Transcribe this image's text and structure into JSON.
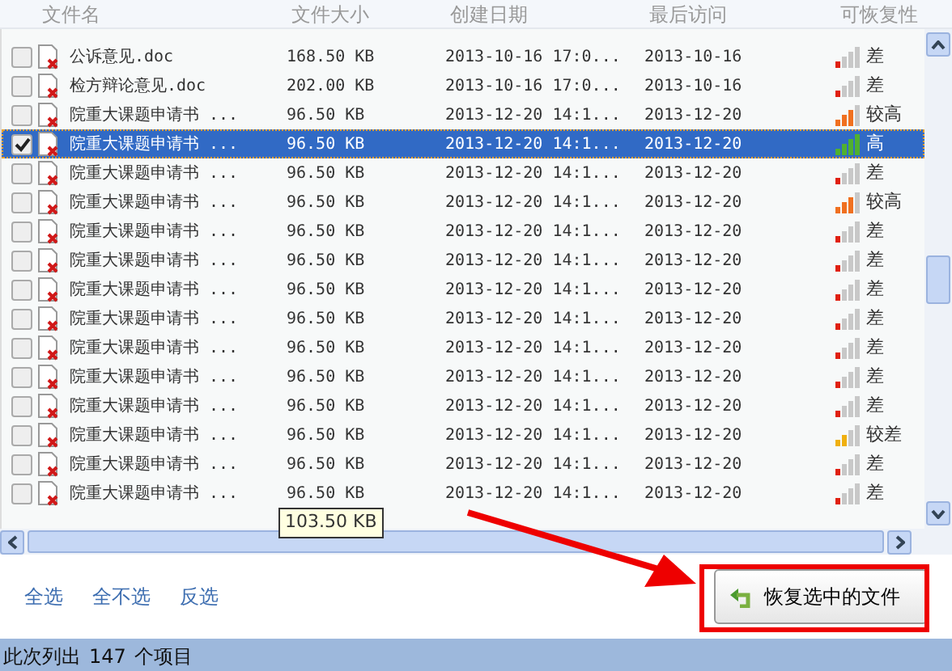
{
  "table": {
    "columns": [
      "文件名",
      "文件大小",
      "创建日期",
      "最后访问",
      "可恢复性"
    ],
    "rows": [
      {
        "name": "公诉意见.doc",
        "size": "168.50 KB",
        "created": "2013-10-16 17:0...",
        "accessed": "2013-10-16",
        "recoverability": "差",
        "level": 0.25,
        "color": "#e02010",
        "checked": false,
        "selected": false
      },
      {
        "name": "检方辩论意见.doc",
        "size": "202.00 KB",
        "created": "2013-10-16 17:0...",
        "accessed": "2013-10-16",
        "recoverability": "差",
        "level": 0.25,
        "color": "#e02010",
        "checked": false,
        "selected": false
      },
      {
        "name": "院重大课题申请书 ...",
        "size": "96.50 KB",
        "created": "2013-12-20 14:1...",
        "accessed": "2013-12-20",
        "recoverability": "较高",
        "level": 0.75,
        "color": "#f07020",
        "checked": false,
        "selected": false
      },
      {
        "name": "院重大课题申请书 ...",
        "size": "96.50 KB",
        "created": "2013-12-20 14:1...",
        "accessed": "2013-12-20",
        "recoverability": "高",
        "level": 1,
        "color": "#50b030",
        "checked": true,
        "selected": true
      },
      {
        "name": "院重大课题申请书 ...",
        "size": "96.50 KB",
        "created": "2013-12-20 14:1...",
        "accessed": "2013-12-20",
        "recoverability": "差",
        "level": 0.25,
        "color": "#e02010",
        "checked": false,
        "selected": false
      },
      {
        "name": "院重大课题申请书 ...",
        "size": "96.50 KB",
        "created": "2013-12-20 14:1...",
        "accessed": "2013-12-20",
        "recoverability": "较高",
        "level": 0.75,
        "color": "#f07020",
        "checked": false,
        "selected": false
      },
      {
        "name": "院重大课题申请书 ...",
        "size": "96.50 KB",
        "created": "2013-12-20 14:1...",
        "accessed": "2013-12-20",
        "recoverability": "差",
        "level": 0.25,
        "color": "#e02010",
        "checked": false,
        "selected": false
      },
      {
        "name": "院重大课题申请书 ...",
        "size": "96.50 KB",
        "created": "2013-12-20 14:1...",
        "accessed": "2013-12-20",
        "recoverability": "差",
        "level": 0.25,
        "color": "#e02010",
        "checked": false,
        "selected": false
      },
      {
        "name": "院重大课题申请书 ...",
        "size": "96.50 KB",
        "created": "2013-12-20 14:1...",
        "accessed": "2013-12-20",
        "recoverability": "差",
        "level": 0.25,
        "color": "#e02010",
        "checked": false,
        "selected": false
      },
      {
        "name": "院重大课题申请书 ...",
        "size": "96.50 KB",
        "created": "2013-12-20 14:1...",
        "accessed": "2013-12-20",
        "recoverability": "差",
        "level": 0.25,
        "color": "#e02010",
        "checked": false,
        "selected": false
      },
      {
        "name": "院重大课题申请书 ...",
        "size": "96.50 KB",
        "created": "2013-12-20 14:1...",
        "accessed": "2013-12-20",
        "recoverability": "差",
        "level": 0.25,
        "color": "#e02010",
        "checked": false,
        "selected": false
      },
      {
        "name": "院重大课题申请书 ...",
        "size": "96.50 KB",
        "created": "2013-12-20 14:1...",
        "accessed": "2013-12-20",
        "recoverability": "差",
        "level": 0.25,
        "color": "#e02010",
        "checked": false,
        "selected": false
      },
      {
        "name": "院重大课题申请书 ...",
        "size": "96.50 KB",
        "created": "2013-12-20 14:1...",
        "accessed": "2013-12-20",
        "recoverability": "差",
        "level": 0.25,
        "color": "#e02010",
        "checked": false,
        "selected": false
      },
      {
        "name": "院重大课题申请书 ...",
        "size": "96.50 KB",
        "created": "2013-12-20 14:1...",
        "accessed": "2013-12-20",
        "recoverability": "较差",
        "level": 0.5,
        "color": "#f0b010",
        "checked": false,
        "selected": false
      },
      {
        "name": "院重大课题申请书 ...",
        "size": "96.50 KB",
        "created": "2013-12-20 14:1...",
        "accessed": "2013-12-20",
        "recoverability": "差",
        "level": 0.25,
        "color": "#e02010",
        "checked": false,
        "selected": false
      },
      {
        "name": "院重大课题申请书 ...",
        "size": "96.50 KB",
        "created": "2013-12-20 14:1...",
        "accessed": "2013-12-20",
        "recoverability": "差",
        "level": 0.25,
        "color": "#e02010",
        "checked": false,
        "selected": false
      }
    ]
  },
  "tooltip": "103.50 KB",
  "links": [
    "全选",
    "全不选",
    "反选"
  ],
  "recover_button": "恢复选中的文件",
  "status_bar": {
    "prefix": "此次列出",
    "count": "147",
    "suffix": "个项目"
  }
}
